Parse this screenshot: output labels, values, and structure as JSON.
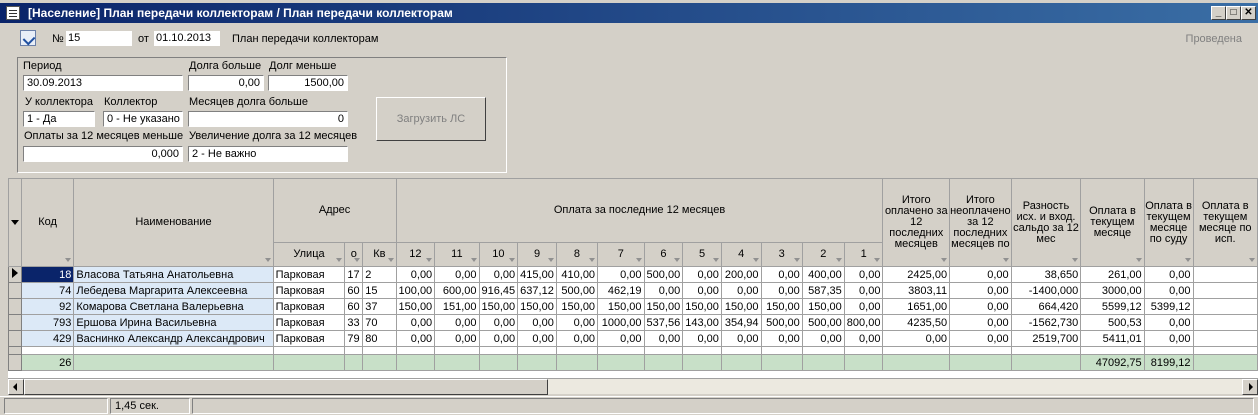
{
  "window": {
    "title": "[Население] План передачи коллекторам / План передачи коллекторам",
    "min_glyph": "_",
    "max_glyph": "□",
    "close_glyph": "✕"
  },
  "toolbar": {
    "number_label": "№",
    "number_value": "15",
    "from_label": "от",
    "date_value": "01.10.2013",
    "doc_type": "План передачи коллекторам",
    "status": "Проведена"
  },
  "filters": {
    "period_label": "Период",
    "period_value": "30.09.2013",
    "debt_more_label": "Долга больше",
    "debt_more_value": "0,00",
    "debt_less_label": "Долг меньше",
    "debt_less_value": "1500,00",
    "at_collector_label": "У коллектора",
    "at_collector_value": "1 - Да",
    "collector_label": "Коллектор",
    "collector_value": "0 - Не указано",
    "months_debt_label": "Месяцев долга больше",
    "months_debt_value": "0",
    "payments_less_label": "Оплаты за 12 месяцев меньше",
    "payments_less_value": "0,000",
    "debt_increase_label": "Увеличение долга за 12 месяцев",
    "debt_increase_value": "2 - Не важно",
    "load_button": "Загрузить ЛС"
  },
  "grid": {
    "headers": {
      "code": "Код",
      "name": "Наименование",
      "address": "Адрес",
      "street": "Улица",
      "house": "о",
      "apt": "Кв",
      "payments_group": "Оплата за последние  12 месяцев",
      "months": [
        "12",
        "11",
        "10",
        "9",
        "8",
        "7",
        "6",
        "5",
        "4",
        "3",
        "2",
        "1"
      ],
      "total_paid": "Итого оплачено за 12 последних месяцев",
      "unpaid_months": "Итого неоплачено за 12 последних месяцев по",
      "balance_diff": "Разность исх. и вход. сальдо за 12 мес",
      "pay_current": "Оплата в текущем месяце",
      "pay_current_court": "Оплата в текущем месяце по суду",
      "pay_current_exec": "Оплата в текущем месяце по исп."
    },
    "rows": [
      {
        "code": "18",
        "name": "Власова Татьяна Анатольевна",
        "street": "Парковая",
        "house": "17",
        "apt": "2",
        "m": [
          "0,00",
          "0,00",
          "0,00",
          "415,00",
          "410,00",
          "0,00",
          "500,00",
          "0,00",
          "200,00",
          "0,00",
          "400,00",
          "0,00"
        ],
        "total": "2425,00",
        "unpaid": "0,00",
        "diff": "38,650",
        "cur": "261,00",
        "court": "0,00",
        "exec": ""
      },
      {
        "code": "74",
        "name": "Лебедева Маргарита Алексеевна",
        "street": "Парковая",
        "house": "60",
        "apt": "15",
        "m": [
          "100,00",
          "600,00",
          "916,45",
          "637,12",
          "500,00",
          "462,19",
          "0,00",
          "0,00",
          "0,00",
          "0,00",
          "587,35",
          "0,00"
        ],
        "total": "3803,11",
        "unpaid": "0,00",
        "diff": "-1400,000",
        "cur": "3000,00",
        "court": "0,00",
        "exec": ""
      },
      {
        "code": "92",
        "name": "Комарова Светлана Валерьевна",
        "street": "Парковая",
        "house": "60",
        "apt": "37",
        "m": [
          "150,00",
          "151,00",
          "150,00",
          "150,00",
          "150,00",
          "150,00",
          "150,00",
          "150,00",
          "150,00",
          "150,00",
          "150,00",
          "0,00"
        ],
        "total": "1651,00",
        "unpaid": "0,00",
        "diff": "664,420",
        "cur": "5599,12",
        "court": "5399,12",
        "exec": ""
      },
      {
        "code": "793",
        "name": "Ершова Ирина Васильевна",
        "street": "Парковая",
        "house": "33",
        "apt": "70",
        "m": [
          "0,00",
          "0,00",
          "0,00",
          "0,00",
          "0,00",
          "1000,00",
          "537,56",
          "143,00",
          "354,94",
          "500,00",
          "500,00",
          "800,00"
        ],
        "total": "4235,50",
        "unpaid": "0,00",
        "diff": "-1562,730",
        "cur": "500,53",
        "court": "0,00",
        "exec": ""
      },
      {
        "code": "429",
        "name": "Васнинко Александр Александрович",
        "street": "Парковая",
        "house": "79",
        "apt": "80",
        "m": [
          "0,00",
          "0,00",
          "0,00",
          "0,00",
          "0,00",
          "0,00",
          "0,00",
          "0,00",
          "0,00",
          "0,00",
          "0,00",
          "0,00"
        ],
        "total": "0,00",
        "unpaid": "0,00",
        "diff": "2519,700",
        "cur": "5411,01",
        "court": "0,00",
        "exec": ""
      }
    ],
    "totals": {
      "count": "26",
      "cur": "47092,75",
      "court": "8199,12"
    }
  },
  "statusbar": {
    "elapsed": "1,45 сек."
  }
}
